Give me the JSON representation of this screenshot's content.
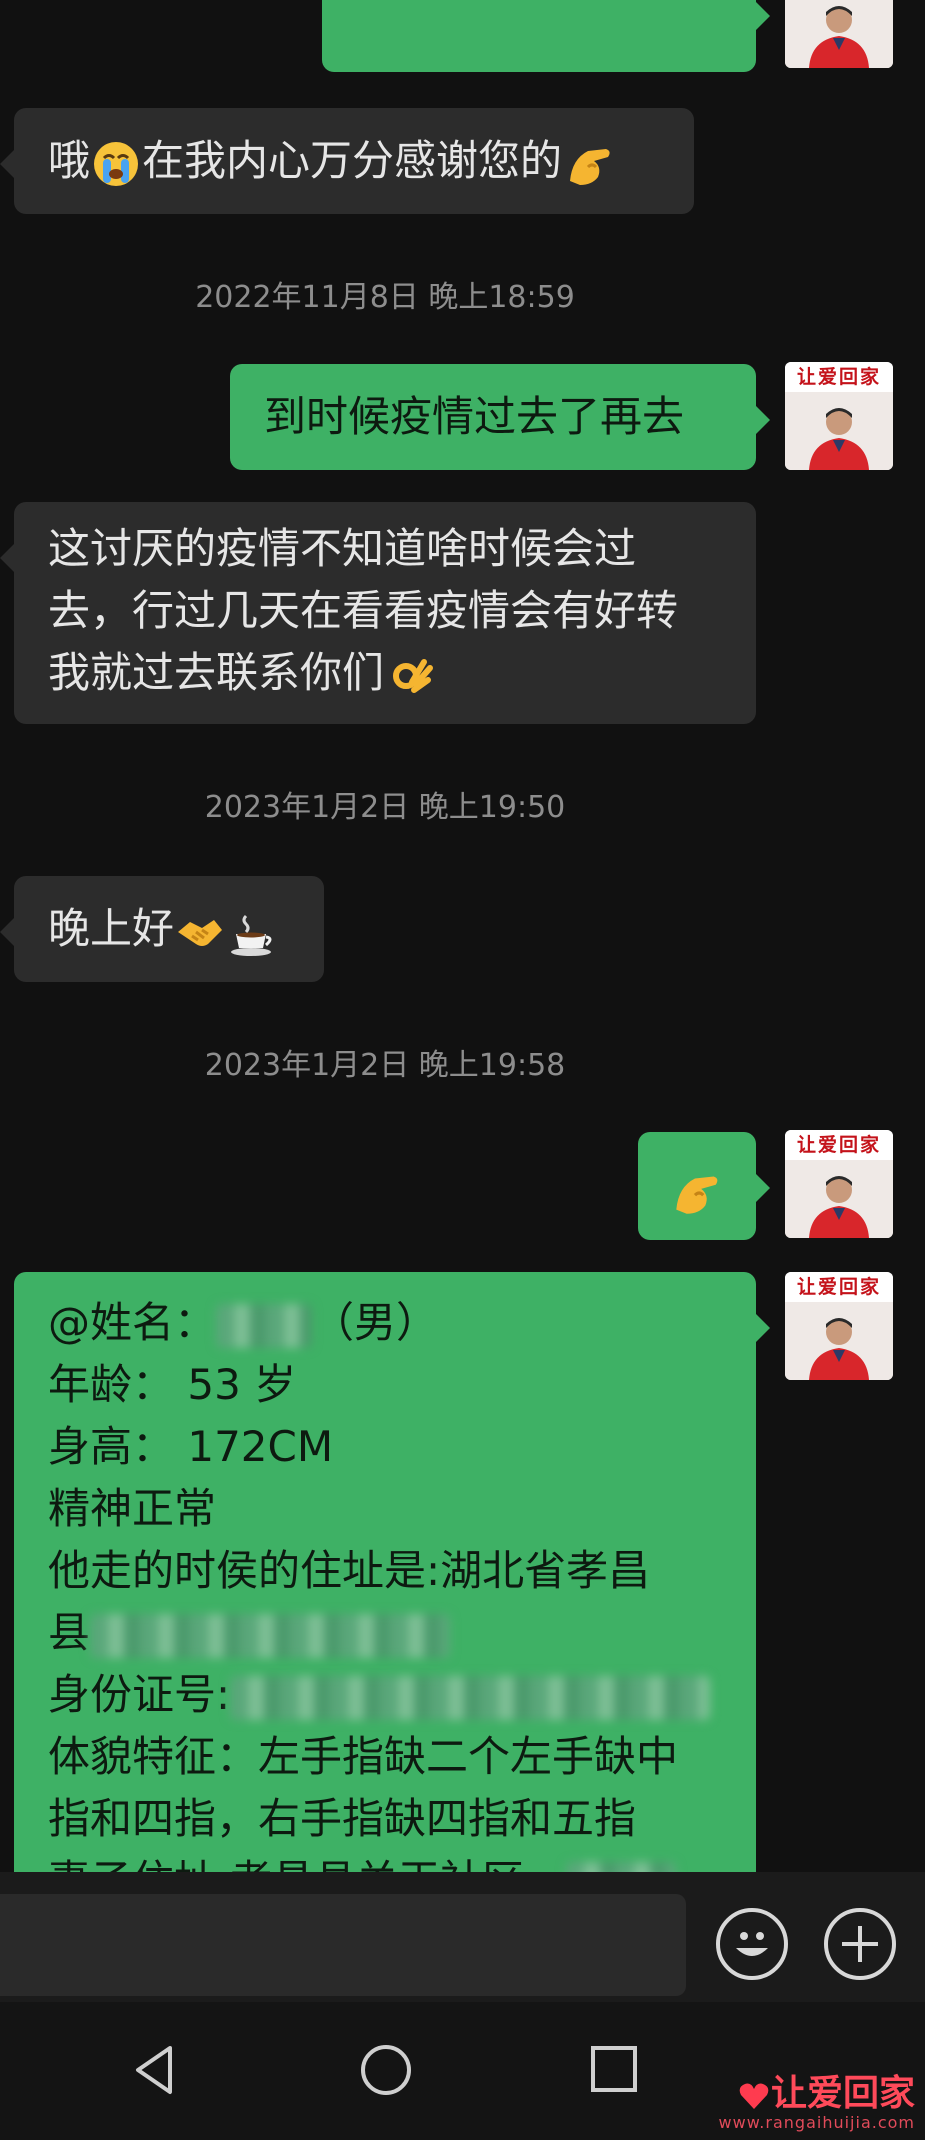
{
  "avatar": {
    "banner": "让爱回家",
    "vest_label": "让爱"
  },
  "messages": {
    "top_partial": "",
    "m1": {
      "text": "哦",
      "text2": "在我内心万分感谢您的"
    },
    "ts1": "2022年11月8日 晚上18:59",
    "m2": {
      "text": "到时候疫情过去了再去"
    },
    "m3": {
      "lines": [
        "这讨厌的疫情不知道啥时候会过",
        "去，行过几天在看看疫情会有好转",
        "我就过去联系你们"
      ]
    },
    "ts2": "2023年1月2日 晚上19:50",
    "m4": {
      "text": "晚上好"
    },
    "ts3": "2023年1月2日 晚上19:58",
    "m6": {
      "name_label": "@姓名：",
      "gender": "（男）",
      "age": "年龄：  53 岁",
      "height": "身高：  172CM",
      "mental": "精神正常",
      "address1": "他走的时侯的住址是:湖北省孝昌",
      "address2": "县",
      "id_label": "身份证号:",
      "features1": "体貌特征：左手指缺二个左手缺中",
      "features2": "指和四指，右手指缺四指和五指",
      "spouse": "妻子住址:孝昌县关王社区，"
    }
  },
  "input_bar": {
    "emoji_button": "emoji-icon",
    "plus_button": "plus-icon"
  },
  "nav": {
    "back": "back-icon",
    "home": "home-icon",
    "recents": "recents-icon"
  },
  "watermark": {
    "name": "让爱回家",
    "url": "www.rangaihuijia.com"
  },
  "colors": {
    "outgoing": "#3eb165",
    "incoming": "#2c2c2c",
    "background": "#111111"
  }
}
